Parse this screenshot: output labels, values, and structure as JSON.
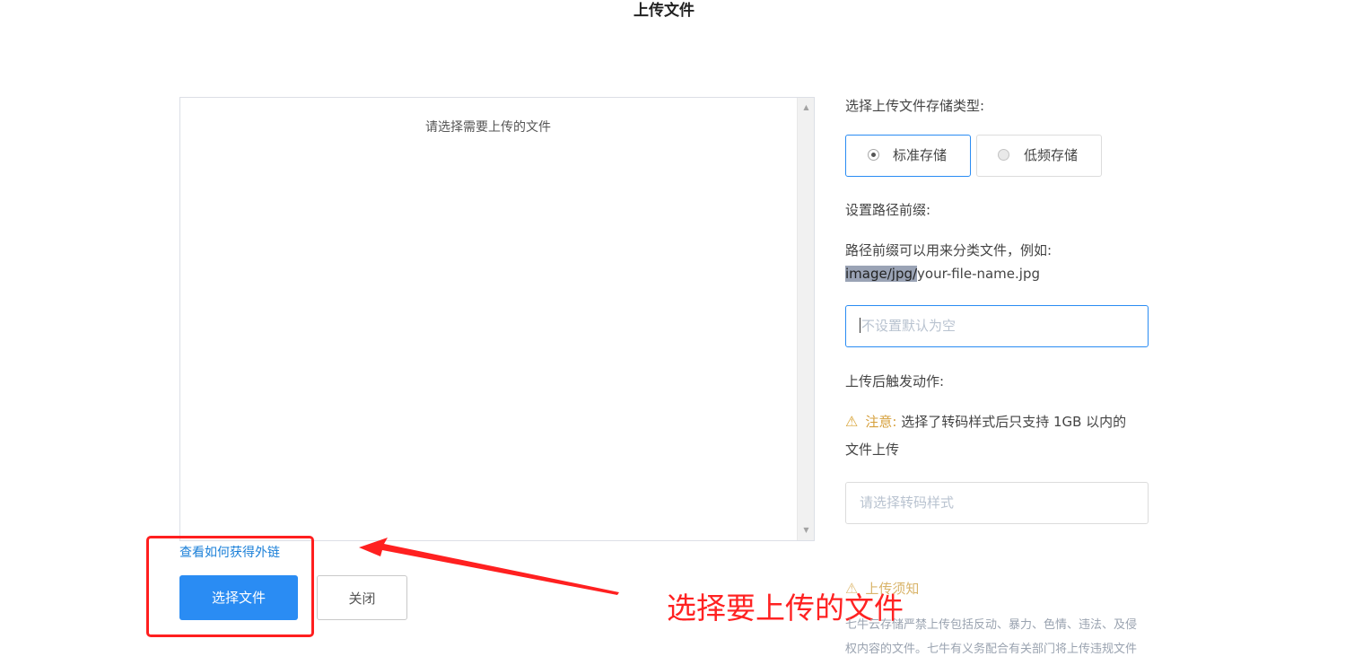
{
  "page_title": "上传文件",
  "file_panel": {
    "prompt": "请选择需要上传的文件"
  },
  "left_actions": {
    "link": "查看如何获得外链",
    "select_button": "选择文件",
    "close_button": "关闭"
  },
  "annotation": {
    "text": "选择要上传的文件",
    "color": "#ff2222"
  },
  "storage": {
    "label": "选择上传文件存储类型:",
    "options": [
      {
        "label": "标准存储",
        "selected": true
      },
      {
        "label": "低频存储",
        "selected": false
      }
    ]
  },
  "prefix": {
    "label": "设置路径前缀:",
    "hint": "路径前缀可以用来分类文件，例如:",
    "example_highlight": "image/jpg/",
    "example_rest": "your-file-name.jpg",
    "placeholder": "不设置默认为空"
  },
  "trigger": {
    "label": "上传后触发动作:",
    "warning_strong": "注意:",
    "warning_text": "选择了转码样式后只支持 1GB 以内的",
    "warning_text_2": "文件上传",
    "placeholder": "请选择转码样式"
  },
  "notice": {
    "title": "上传须知",
    "text_1": "七牛云存储严禁上传包括反动、暴力、色情、违法、及侵",
    "text_2": "权内容的文件。七牛有义务配合有关部门将上传违规文件"
  },
  "colors": {
    "accent": "#2a8cf3",
    "warning": "#d9a53a",
    "annotation": "#ff1f1f"
  }
}
